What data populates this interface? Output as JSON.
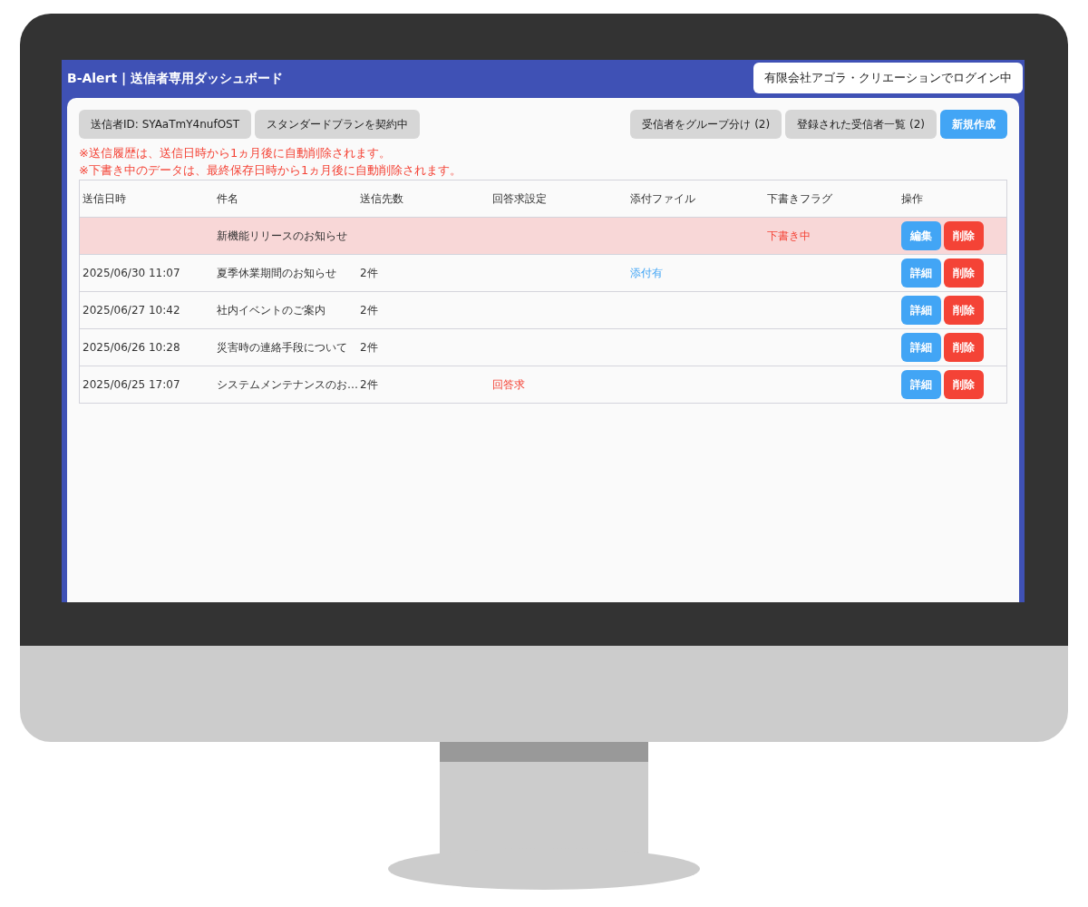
{
  "header": {
    "title": "B-Alert | 送信者専用ダッシュボード",
    "login_status": "有限会社アゴラ・クリエーションでログイン中"
  },
  "toolbar": {
    "left": [
      {
        "label": "送信者ID: SYAaTmY4nufOST",
        "kind": "info"
      },
      {
        "label": "スタンダードプランを契約中",
        "kind": "info"
      }
    ],
    "right": [
      {
        "label": "受信者をグループ分け (2)",
        "kind": "secondary"
      },
      {
        "label": "登録された受信者一覧 (2)",
        "kind": "secondary"
      },
      {
        "label": "新規作成",
        "kind": "primary"
      }
    ]
  },
  "notices": [
    "※送信履歴は、送信日時から1ヵ月後に自動削除されます。",
    "※下書き中のデータは、最終保存日時から1ヵ月後に自動削除されます。"
  ],
  "table": {
    "columns": [
      "送信日時",
      "件名",
      "送信先数",
      "回答求設定",
      "添付ファイル",
      "下書きフラグ",
      "操作"
    ],
    "rows": [
      {
        "draft": true,
        "sent_at": "",
        "subject": "新機能リリースのお知らせ",
        "recipients": "",
        "reply_required": "",
        "attachment": "",
        "draft_flag": "下書き中",
        "actions": [
          {
            "label": "編集",
            "kind": "primary"
          },
          {
            "label": "削除",
            "kind": "danger"
          }
        ]
      },
      {
        "draft": false,
        "sent_at": "2025/06/30 11:07",
        "subject": "夏季休業期間のお知らせ",
        "recipients": "2件",
        "reply_required": "",
        "attachment": "添付有",
        "draft_flag": "",
        "actions": [
          {
            "label": "詳細",
            "kind": "primary"
          },
          {
            "label": "削除",
            "kind": "danger"
          }
        ]
      },
      {
        "draft": false,
        "sent_at": "2025/06/27 10:42",
        "subject": "社内イベントのご案内",
        "recipients": "2件",
        "reply_required": "",
        "attachment": "",
        "draft_flag": "",
        "actions": [
          {
            "label": "詳細",
            "kind": "primary"
          },
          {
            "label": "削除",
            "kind": "danger"
          }
        ]
      },
      {
        "draft": false,
        "sent_at": "2025/06/26 10:28",
        "subject": "災害時の連絡手段について",
        "recipients": "2件",
        "reply_required": "",
        "attachment": "",
        "draft_flag": "",
        "actions": [
          {
            "label": "詳細",
            "kind": "primary"
          },
          {
            "label": "削除",
            "kind": "danger"
          }
        ]
      },
      {
        "draft": false,
        "sent_at": "2025/06/25 17:07",
        "subject": "システムメンテナンスのお…",
        "recipients": "2件",
        "reply_required": "回答求",
        "attachment": "",
        "draft_flag": "",
        "actions": [
          {
            "label": "詳細",
            "kind": "primary"
          },
          {
            "label": "削除",
            "kind": "danger"
          }
        ]
      }
    ]
  }
}
